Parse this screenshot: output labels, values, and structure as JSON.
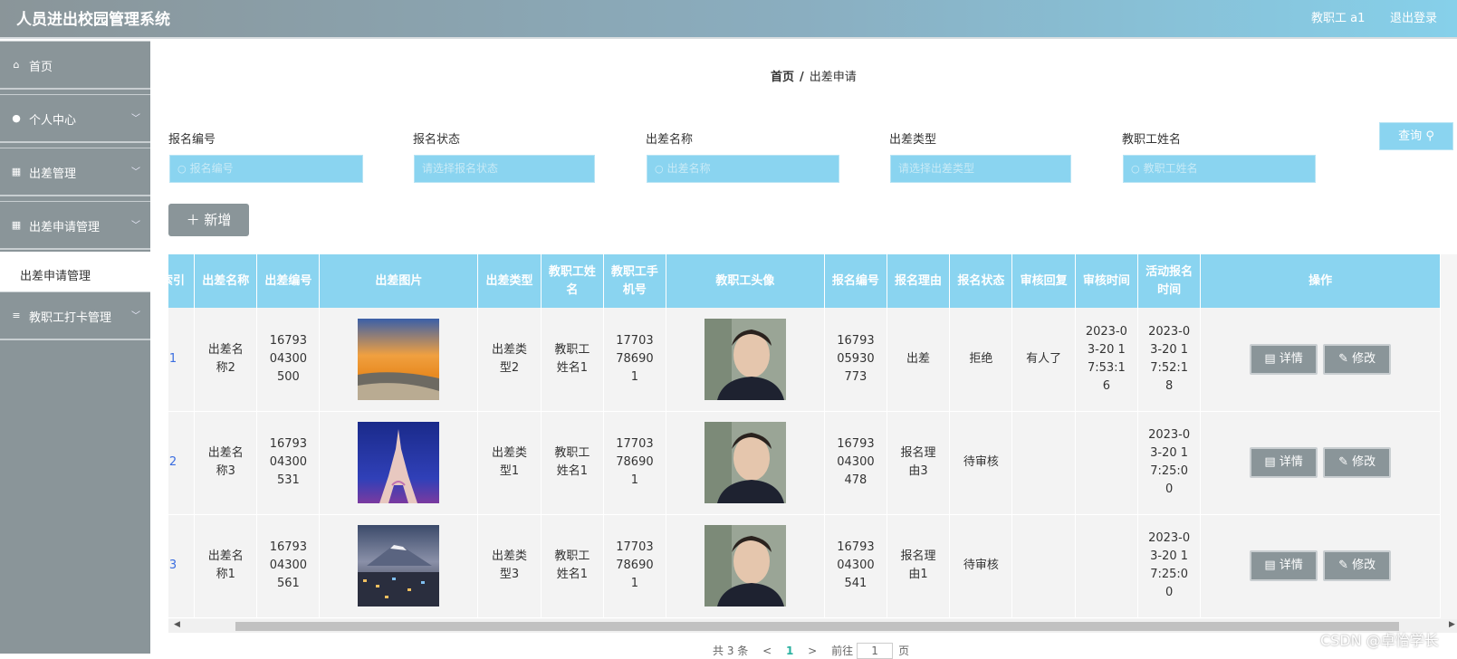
{
  "header": {
    "title": "人员进出校园管理系统",
    "user": "教职工 a1",
    "logout": "退出登录"
  },
  "sidebar": {
    "items": [
      {
        "label": "首页",
        "icon": "home-icon"
      },
      {
        "label": "个人中心",
        "icon": "user-icon"
      },
      {
        "label": "出差管理",
        "icon": "grid-icon"
      },
      {
        "label": "出差申请管理",
        "icon": "grid-icon"
      },
      {
        "label": "教职工打卡管理",
        "icon": "list-icon"
      }
    ],
    "sub_item": "出差申请管理"
  },
  "breadcrumb": {
    "home": "首页",
    "sep": "/",
    "current": "出差申请"
  },
  "filters": [
    {
      "label": "报名编号",
      "placeholder": "报名编号"
    },
    {
      "label": "报名状态",
      "placeholder": "请选择报名状态"
    },
    {
      "label": "出差名称",
      "placeholder": "出差名称"
    },
    {
      "label": "出差类型",
      "placeholder": "请选择出差类型"
    },
    {
      "label": "教职工姓名",
      "placeholder": "教职工姓名"
    }
  ],
  "query_button": "查询",
  "add_button": "新增",
  "table": {
    "columns": [
      "索引",
      "出差名称",
      "出差编号",
      "出差图片",
      "出差类型",
      "教职工姓名",
      "教职工手机号",
      "教职工头像",
      "报名编号",
      "报名理由",
      "报名状态",
      "审核回复",
      "审核时间",
      "活动报名时间",
      "操作"
    ],
    "rows": [
      {
        "index": "1",
        "name": "出差名称2",
        "code": "1679304300500",
        "photo": "beach",
        "type": "出差类型2",
        "staff_name": "教职工姓名1",
        "phone": "17703786901",
        "signup_code": "1679305930773",
        "reason": "出差",
        "status": "拒绝",
        "reply": "有人了",
        "review_time": "2023-03-20 17:53:16",
        "signup_time": "2023-03-20 17:52:18"
      },
      {
        "index": "2",
        "name": "出差名称3",
        "code": "1679304300531",
        "photo": "tower",
        "type": "出差类型1",
        "staff_name": "教职工姓名1",
        "phone": "17703786901",
        "signup_code": "1679304300478",
        "reason": "报名理由3",
        "status": "待审核",
        "reply": "",
        "review_time": "",
        "signup_time": "2023-03-20 17:25:00"
      },
      {
        "index": "3",
        "name": "出差名称1",
        "code": "1679304300561",
        "photo": "city",
        "type": "出差类型3",
        "staff_name": "教职工姓名1",
        "phone": "17703786901",
        "signup_code": "1679304300541",
        "reason": "报名理由1",
        "status": "待审核",
        "reply": "",
        "review_time": "",
        "signup_time": "2023-03-20 17:25:00"
      }
    ],
    "detail_label": "详情",
    "edit_label": "修改"
  },
  "pager": {
    "total": "共 3 条",
    "prev": "<",
    "current": "1",
    "next": ">",
    "goto": "前往",
    "page_value": "1",
    "page_unit": "页"
  },
  "watermark": "CSDN @卓怡学长",
  "colors": {
    "accent": "#8ad4f0",
    "sidebar": "#8a9599"
  }
}
